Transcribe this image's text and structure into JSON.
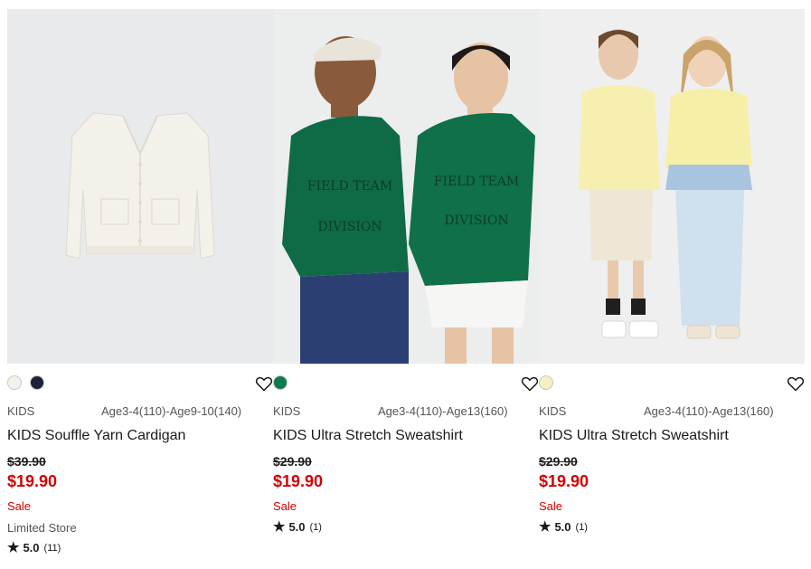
{
  "products": [
    {
      "swatches": [
        "#f4f1ea",
        "#1d2238"
      ],
      "category": "KIDS",
      "sizes": "Age3-4(110)-Age9-10(140)",
      "name": "KIDS Souffle Yarn Cardigan",
      "original_price": "$39.90",
      "sale_price": "$19.90",
      "flag": "Sale",
      "store_note": "Limited Store",
      "rating": "5.0",
      "review_count": "(11)",
      "image_bg": "#e9eaec"
    },
    {
      "swatches": [
        "#0c7a4e"
      ],
      "category": "KIDS",
      "sizes": "Age3-4(110)-Age13(160)",
      "name": "KIDS Ultra Stretch Sweatshirt",
      "original_price": "$29.90",
      "sale_price": "$19.90",
      "flag": "Sale",
      "rating": "5.0",
      "review_count": "(1)",
      "image_bg": "#eceded"
    },
    {
      "swatches": [
        "#f5efc2"
      ],
      "category": "KIDS",
      "sizes": "Age3-4(110)-Age13(160)",
      "name": "KIDS Ultra Stretch Sweatshirt",
      "original_price": "$29.90",
      "sale_price": "$19.90",
      "flag": "Sale",
      "rating": "5.0",
      "review_count": "(1)",
      "image_bg": "#efefef"
    }
  ],
  "icons": {
    "favorite": "heart-outline-icon",
    "rating": "star-icon"
  },
  "colors": {
    "sale": "#d30000",
    "text": "#1b1b1b",
    "muted": "#555555"
  }
}
